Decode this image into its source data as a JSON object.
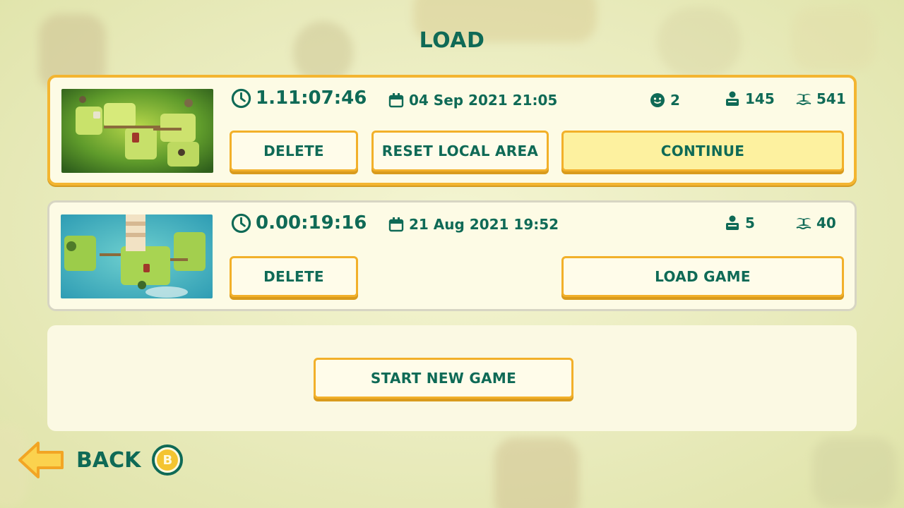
{
  "screen": {
    "title": "LOAD"
  },
  "saves": [
    {
      "playtime": "1.11:07:46",
      "date": "04 Sep 2021 21:05",
      "faces": "2",
      "people": "145",
      "islands": "541",
      "buttons": {
        "delete": "DELETE",
        "reset": "RESET LOCAL AREA",
        "primary": "CONTINUE"
      }
    },
    {
      "playtime": "0.00:19:16",
      "date": "21 Aug 2021 19:52",
      "people": "5",
      "islands": "40",
      "buttons": {
        "delete": "DELETE",
        "primary": "LOAD GAME"
      }
    }
  ],
  "new_game": {
    "label": "START NEW GAME"
  },
  "back": {
    "label": "BACK",
    "key": "B"
  },
  "colors": {
    "accent": "#f3b531",
    "text": "#0f6a56",
    "card": "#fdfbe5",
    "primary_button": "#fdf19f"
  },
  "icons": {
    "time": "clock-icon",
    "date": "calendar-icon",
    "faces": "smiley-icon",
    "people": "person-icon",
    "islands": "island-icon",
    "back": "arrow-left-icon"
  }
}
